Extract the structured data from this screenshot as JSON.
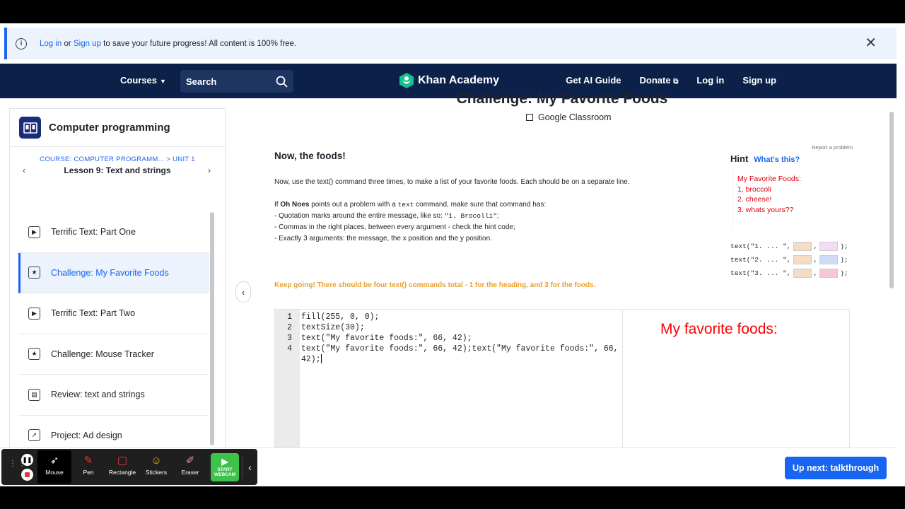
{
  "banner": {
    "login_link": "Log in",
    "or": " or ",
    "signup_link": "Sign up",
    "message": " to save your future progress! All content is 100% free.",
    "close_glyph": "✕"
  },
  "nav": {
    "courses": "Courses",
    "search_label": "Search",
    "logo_text": "Khan Academy",
    "ai_guide": "Get AI Guide",
    "donate": "Donate",
    "login": "Log in",
    "signup": "Sign up"
  },
  "sidebar": {
    "title": "Computer programming",
    "course_crumb": "COURSE: COMPUTER PROGRAMM... > UNIT 1",
    "lesson": "Lesson 9: Text and strings",
    "items": [
      {
        "label": "Terrific Text: Part One",
        "icon": "play-icon",
        "glyph": "▶",
        "active": false
      },
      {
        "label": "Challenge: My Favorite Foods",
        "icon": "star-icon",
        "glyph": "★",
        "active": true
      },
      {
        "label": "Terrific Text: Part Two",
        "icon": "play-icon",
        "glyph": "▶",
        "active": false
      },
      {
        "label": "Challenge: Mouse Tracker",
        "icon": "star-icon",
        "glyph": "★",
        "active": false
      },
      {
        "label": "Review: text and strings",
        "icon": "document-icon",
        "glyph": "▤",
        "active": false
      },
      {
        "label": "Project: Ad design",
        "icon": "rocket-icon",
        "glyph": "➚",
        "active": false
      }
    ]
  },
  "main": {
    "title": "Challenge: My Favorite Foods",
    "classroom": "Google Classroom",
    "report": "Report a problem",
    "heading": "Now, the foods!",
    "para1": "Now, use the text() command three times, to make a list of your favorite foods. Each should be on a separate line.",
    "if_prefix": "If ",
    "oh_noes": "Oh Noes",
    "if_mid": " points out a problem with a ",
    "text_mono": "text",
    "if_suffix": " command, make sure that command has:",
    "bullet1_prefix": "- Quotation marks around the entire message, like so: ",
    "bullet1_mono": "\"1. Brocolli\"",
    "bullet1_suffix": ";",
    "bullet2": "- Commas in the right places, between every argument - check the hint code;",
    "bullet3": "- Exactly 3 arguments: the message, the x position and the y position.",
    "keep_going": "Keep going! There should be four text() commands total - 1 for the heading, and 3 for the foods."
  },
  "hint": {
    "label": "Hint",
    "whats_this": "What's this?",
    "preview_lines": [
      "My Favorite Foods:",
      "1. broccoli",
      "2. cheese!",
      "3. whats yours??"
    ],
    "code_rows": [
      {
        "prefix": "text(\"1. ... \",",
        "mid": ",",
        "end": ");",
        "c1": "#f5dcc4",
        "c2": "#f5dcf5"
      },
      {
        "prefix": "text(\"2. ... \",",
        "mid": ",",
        "end": ");",
        "c1": "#f5dcc4",
        "c2": "#d0dcf5"
      },
      {
        "prefix": "text(\"3. ... \",",
        "mid": ",",
        "end": ");",
        "c1": "#f5dcc4",
        "c2": "#f5c8d4"
      }
    ]
  },
  "editor": {
    "lines": [
      {
        "num": "1",
        "code": "fill(255, 0, 0);"
      },
      {
        "num": "2",
        "code": "textSize(30);"
      },
      {
        "num": "3",
        "code": "text(\"My favorite foods:\", 66, 42);"
      },
      {
        "num": "4",
        "code": "text(\"My favorite foods:\", 66, 42);text(\"My favorite foods:\", 66,"
      },
      {
        "num": "",
        "code": "42);"
      }
    ]
  },
  "canvas": {
    "output_text": "My favorite foods:"
  },
  "footer": {
    "up_next": "Up next: talkthrough"
  },
  "recorder": {
    "pause_glyph": "❚❚",
    "tools": [
      {
        "label": "Mouse",
        "icon": "mouse-cursor-icon",
        "glyph": "➶",
        "color": "#ffffff",
        "selected": true
      },
      {
        "label": "Pen",
        "icon": "pen-icon",
        "glyph": "✎",
        "color": "#e53935",
        "selected": false
      },
      {
        "label": "Rectangle",
        "icon": "rectangle-icon",
        "glyph": "▢",
        "color": "#e53935",
        "selected": false
      },
      {
        "label": "Stickers",
        "icon": "sticker-icon",
        "glyph": "☺",
        "color": "#f5b400",
        "selected": false
      },
      {
        "label": "Eraser",
        "icon": "eraser-icon",
        "glyph": "✐",
        "color": "#f48fb1",
        "selected": false
      }
    ],
    "webcam_line1": "START",
    "webcam_line2": "WEBCAM",
    "chevron_glyph": "‹"
  }
}
